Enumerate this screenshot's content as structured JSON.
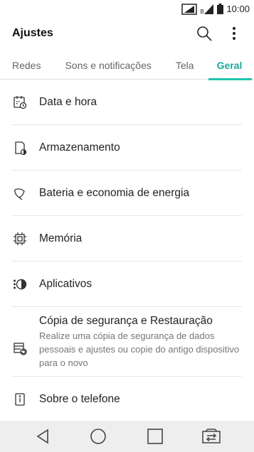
{
  "status_bar": {
    "time": "10:00",
    "sim_label": "B"
  },
  "app_bar": {
    "title": "Ajustes"
  },
  "tabs": [
    {
      "label": "Redes"
    },
    {
      "label": "Sons e notificações"
    },
    {
      "label": "Tela"
    },
    {
      "label": "Geral",
      "selected": true
    }
  ],
  "items": [
    {
      "label": "Data e hora",
      "icon": "calendar-clock-icon"
    },
    {
      "label": "Armazenamento",
      "icon": "storage-icon"
    },
    {
      "label": "Bateria e economia de energia",
      "icon": "battery-saver-icon"
    },
    {
      "label": "Memória",
      "icon": "memory-chip-icon"
    },
    {
      "label": "Aplicativos",
      "icon": "apps-icon"
    },
    {
      "label": "Cópia de segurança e Restauração",
      "sublabel": "Realize uma cópia de segurança de dados pessoais e ajustes ou copie do antigo dispositivo para o novo",
      "icon": "backup-restore-icon"
    },
    {
      "label": "Sobre o telefone",
      "icon": "phone-info-icon"
    }
  ],
  "colors": {
    "accent": "#1aa89a",
    "indicator": "#20c3b0",
    "nav_bg": "#eeeeee"
  }
}
